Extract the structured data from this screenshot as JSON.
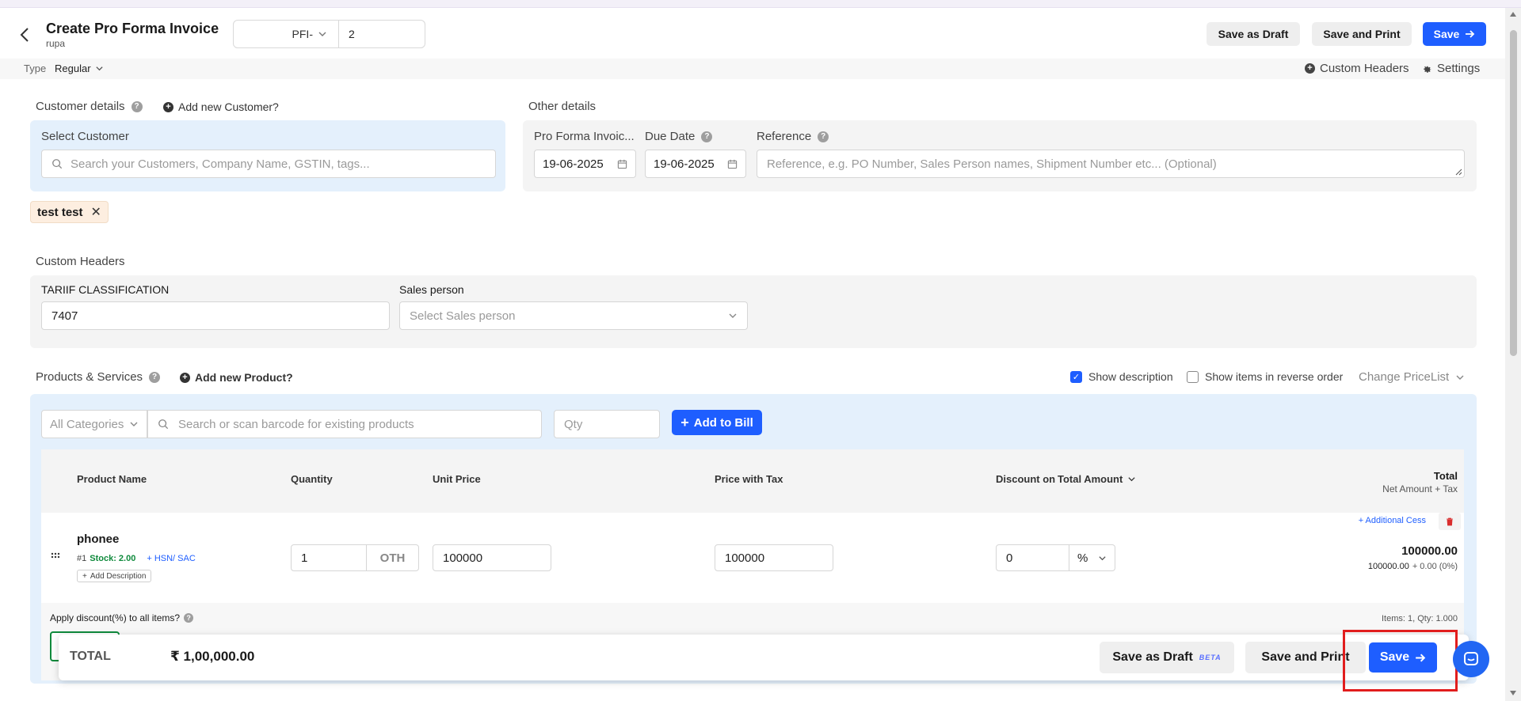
{
  "header": {
    "title": "Create Pro Forma Invoice",
    "subtitle": "rupa",
    "prefix": "PFI-",
    "number": "2",
    "save_draft_label": "Save as Draft",
    "save_print_label": "Save and Print",
    "save_label": "Save"
  },
  "subbar": {
    "type_label": "Type",
    "type_value": "Regular",
    "custom_headers_label": "Custom Headers",
    "settings_label": "Settings"
  },
  "customer": {
    "section_title": "Customer details",
    "add_new_label": "Add new Customer?",
    "select_label": "Select Customer",
    "search_placeholder": "Search your Customers, Company Name, GSTIN, tags...",
    "selected_tag": "test test"
  },
  "other_details": {
    "section_title": "Other details",
    "invoice_date_label": "Pro Forma Invoic...",
    "invoice_date_value": "19-06-2025",
    "due_date_label": "Due Date",
    "due_date_value": "19-06-2025",
    "reference_label": "Reference",
    "reference_placeholder": "Reference, e.g. PO Number, Sales Person names, Shipment Number etc... (Optional)"
  },
  "custom_headers": {
    "section_title": "Custom Headers",
    "tariff_label": "TARIIF CLASSIFICATION",
    "tariff_value": "7407",
    "sales_person_label": "Sales person",
    "sales_person_placeholder": "Select Sales person"
  },
  "products": {
    "section_title": "Products & Services",
    "add_new_label": "Add new Product?",
    "show_description_label": "Show description",
    "show_description_checked": true,
    "reverse_order_label": "Show items in reverse order",
    "reverse_order_checked": false,
    "change_pricelist_label": "Change PriceList",
    "categories_placeholder": "All Categories",
    "search_placeholder": "Search or scan barcode for existing products",
    "qty_placeholder": "Qty",
    "add_to_bill_label": "Add to Bill"
  },
  "table": {
    "headers": {
      "product_name": "Product Name",
      "quantity": "Quantity",
      "unit_price": "Unit Price",
      "price_with_tax": "Price with Tax",
      "discount_on": "Discount on",
      "discount_on_value": "Total Amount",
      "total": "Total",
      "total_sub": "Net Amount + Tax"
    },
    "rows": [
      {
        "name": "phonee",
        "index": "#1",
        "stock": "Stock: 2.00",
        "hsn_link": "+ HSN/ SAC",
        "add_description": "Add Description",
        "quantity": "1",
        "unit": "OTH",
        "unit_price": "100000",
        "price_with_tax": "100000",
        "discount": "0",
        "discount_type": "%",
        "additional_cess": "+ Additional Cess",
        "total": "100000.00",
        "total_breakdown": "100000.00",
        "tax_breakdown": "+ 0.00 (0%)"
      }
    ],
    "apply_discount_label": "Apply discount(%) to all items?",
    "items_summary": "Items: 1, Qty: 1.000"
  },
  "bottom_bar": {
    "total_label": "TOTAL",
    "total_value": "₹ 1,00,000.00",
    "save_draft_label": "Save as Draft",
    "beta_label": "BETA",
    "save_print_label": "Save and Print",
    "save_label": "Save"
  },
  "colors": {
    "accent": "#1e5eff",
    "panel_blue": "#e4f0fc",
    "panel_grey": "#f4f4f4",
    "highlight": "#e11d1d",
    "stock_green": "#0f8a3c"
  }
}
